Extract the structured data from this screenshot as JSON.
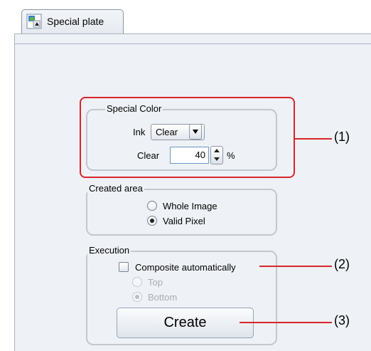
{
  "tab": {
    "label": "Special plate",
    "icon": "special-plate-icon"
  },
  "special_color": {
    "title": "Special Color",
    "ink_label": "Ink",
    "ink_value": "Clear",
    "clear_label": "Clear",
    "clear_value": "40",
    "unit": "%"
  },
  "created_area": {
    "title": "Created area",
    "options": [
      {
        "label": "Whole Image",
        "checked": false
      },
      {
        "label": "Valid Pixel",
        "checked": true
      }
    ]
  },
  "execution": {
    "title": "Execution",
    "composite_label": "Composite automatically",
    "composite_checked": false,
    "position_options": [
      {
        "label": "Top",
        "checked": false
      },
      {
        "label": "Bottom",
        "checked": true
      }
    ],
    "create_label": "Create"
  },
  "callouts": [
    "(1)",
    "(2)",
    "(3)"
  ],
  "colors": {
    "callout": "#d8252c",
    "panel_bg": "#eef1f5",
    "group_border": "#c2c8d0"
  }
}
